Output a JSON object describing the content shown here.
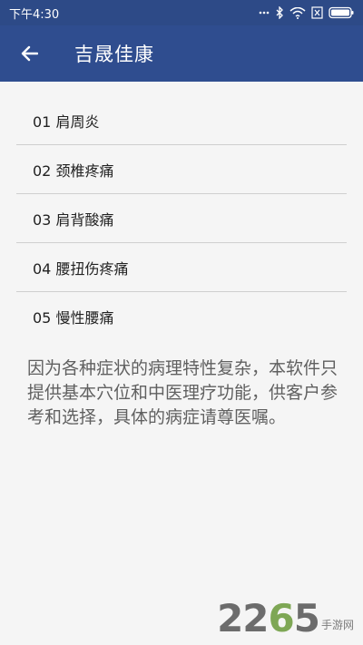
{
  "status_bar": {
    "time": "下午4:30"
  },
  "app_bar": {
    "title": "吉晟佳康",
    "back_icon": "arrow-left-icon"
  },
  "menu": {
    "items": [
      {
        "label": "01 肩周炎"
      },
      {
        "label": "02 颈椎疼痛"
      },
      {
        "label": "03 肩背酸痛"
      },
      {
        "label": "04 腰扭伤疼痛"
      },
      {
        "label": "05 慢性腰痛"
      }
    ]
  },
  "notice": {
    "text": "因为各种症状的病理特性复杂，本软件只提供基本穴位和中医理疗功能，供客户参考和选择，具体的病症请尊医嘱。"
  },
  "watermark": {
    "number_prefix": "22",
    "number_accent": "6",
    "number_suffix": "5",
    "site": "手游网"
  },
  "colors": {
    "app_bar": "#2f4d8f",
    "status_bar": "#2d4a87",
    "background": "#f5f5f5",
    "divider": "#cfcfcf"
  }
}
